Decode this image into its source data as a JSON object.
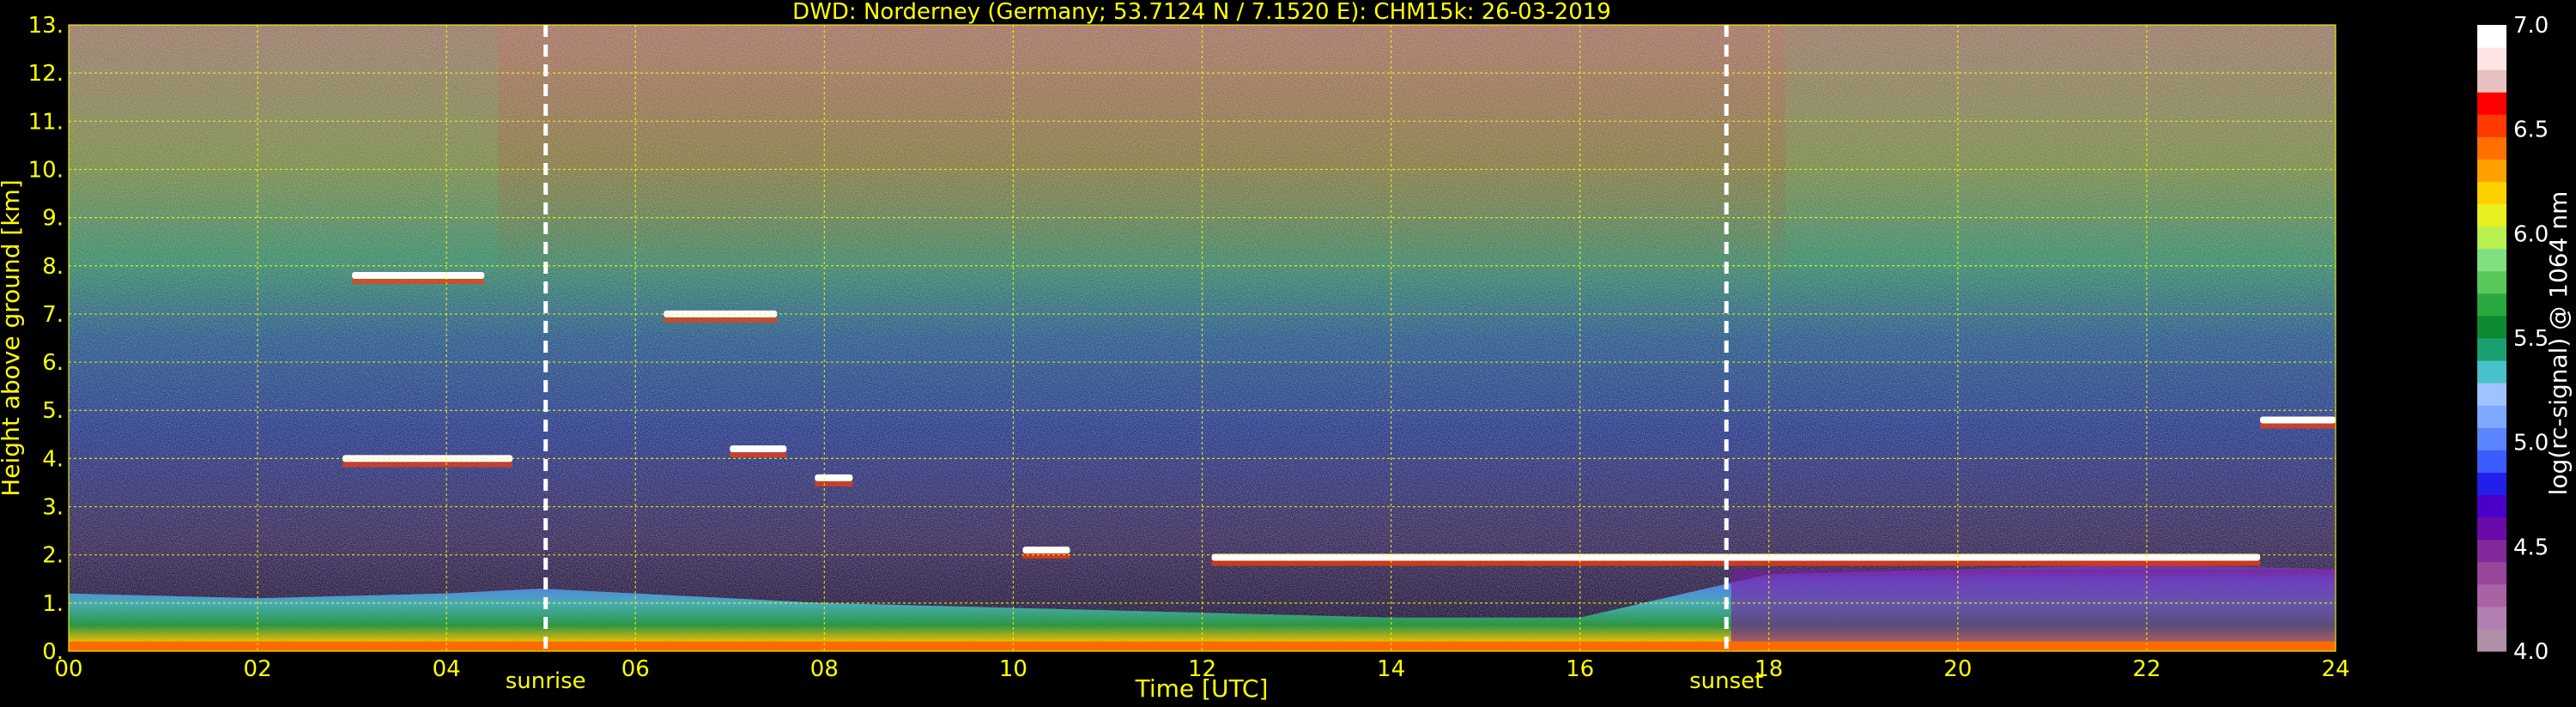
{
  "chart_data": {
    "type": "heatmap",
    "title": "DWD: Norderney (Germany; 53.7124 N / 7.1520 E):    CHM15k: 26-03-2019",
    "xlabel": "Time [UTC]",
    "ylabel": "Height above ground [km]",
    "xlim": [
      0,
      24
    ],
    "ylim": [
      0,
      13
    ],
    "xticks": [
      0,
      2,
      4,
      6,
      8,
      10,
      12,
      14,
      16,
      18,
      20,
      22,
      24
    ],
    "xtick_labels": [
      "00",
      "02",
      "04",
      "06",
      "08",
      "10",
      "12",
      "14",
      "16",
      "18",
      "20",
      "22",
      "24"
    ],
    "yticks": [
      0,
      1,
      2,
      3,
      4,
      5,
      6,
      7,
      8,
      9,
      10,
      11,
      12,
      13
    ],
    "ytick_labels": [
      "0.",
      "1.",
      "2.",
      "3.",
      "4.",
      "5.",
      "6.",
      "7.",
      "8.",
      "9.",
      "10.",
      "11.",
      "12.",
      "13."
    ],
    "grid": true,
    "grid_color": "#ffff00",
    "annotations": [
      {
        "label": "sunrise",
        "time": 5.05
      },
      {
        "label": "sunset",
        "time": 17.55
      }
    ],
    "colorbar": {
      "label": "log(rc-signal) @ 1064 nm",
      "range": [
        4.0,
        7.0
      ],
      "ticks": [
        4.0,
        4.5,
        5.0,
        5.5,
        6.0,
        6.5,
        7.0
      ],
      "tick_labels": [
        "4.0",
        "4.5",
        "5.0",
        "5.5",
        "6.0",
        "6.5",
        "7.0"
      ],
      "colors": [
        "#b08fa8",
        "#b37fb0",
        "#a763a3",
        "#96479a",
        "#82289a",
        "#6a0aa8",
        "#4a00c8",
        "#2020e8",
        "#3d5cff",
        "#5b85ff",
        "#7fa8ff",
        "#9fc3ff",
        "#49c1c8",
        "#1aa070",
        "#0e8a30",
        "#2aa840",
        "#58c858",
        "#80e080",
        "#b8f050",
        "#e8f020",
        "#ffd000",
        "#ffa000",
        "#ff7000",
        "#ff3a00",
        "#ff0000",
        "#e8c0c0",
        "#ffe4e4",
        "#ffffff"
      ]
    },
    "features": {
      "boundary_layer": {
        "top_km": [
          [
            0,
            1.2
          ],
          [
            2,
            1.1
          ],
          [
            4,
            1.2
          ],
          [
            5,
            1.3
          ],
          [
            6,
            1.2
          ],
          [
            8,
            1.0
          ],
          [
            10,
            0.9
          ],
          [
            12,
            0.8
          ],
          [
            14,
            0.7
          ],
          [
            16,
            0.7
          ],
          [
            18,
            1.6
          ],
          [
            20,
            1.7
          ],
          [
            22,
            1.8
          ],
          [
            24,
            1.7
          ]
        ]
      },
      "cloud_layers": [
        {
          "start": 2.9,
          "end": 4.7,
          "height_km": 4.0
        },
        {
          "start": 7.0,
          "end": 7.6,
          "height_km": 4.2
        },
        {
          "start": 7.9,
          "end": 8.3,
          "height_km": 3.6
        },
        {
          "start": 10.1,
          "end": 10.6,
          "height_km": 2.1
        },
        {
          "start": 12.1,
          "end": 23.2,
          "height_km": 1.95
        },
        {
          "start": 23.2,
          "end": 24.0,
          "height_km": 4.8
        },
        {
          "start": 6.3,
          "end": 7.5,
          "height_km": 7.0
        },
        {
          "start": 3.0,
          "end": 4.4,
          "height_km": 7.8
        }
      ]
    }
  }
}
